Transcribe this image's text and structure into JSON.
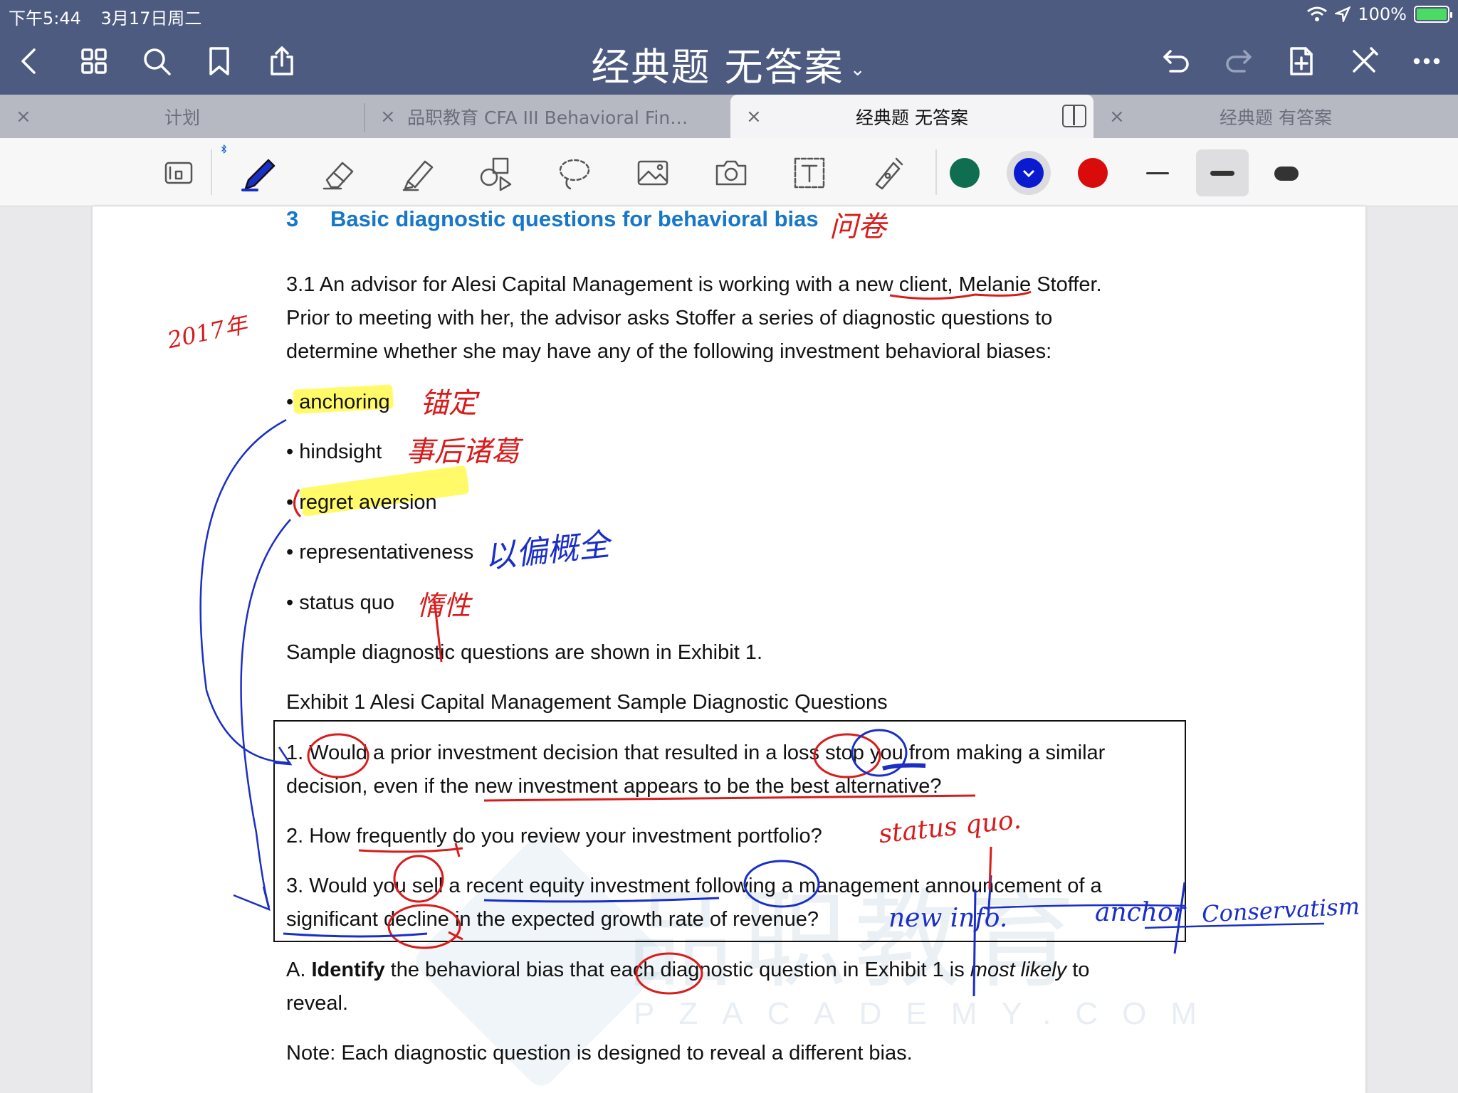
{
  "status_bar": {
    "time": "下午5:44",
    "date": "3月17日周二",
    "battery": "100%"
  },
  "nav": {
    "title": "经典题 无答案",
    "title_caret": "⌄"
  },
  "tabs": [
    {
      "label": "计划",
      "active": false
    },
    {
      "label": "品职教育 CFA III Behavioral Fina...",
      "active": false
    },
    {
      "label": "经典题 无答案",
      "active": true
    },
    {
      "label": "经典题 有答案",
      "active": false
    }
  ],
  "tab_close": "×",
  "toolbar": {
    "colors": [
      "#0e6e4f",
      "#0a1ad0",
      "#d90b0b"
    ],
    "selected_color": "#0a1ad0"
  },
  "document": {
    "heading_number": "3",
    "heading_text": "Basic diagnostic questions for behavioral bias",
    "intro_1": "3.1   An advisor for Alesi Capital Management is working with a new client, Melanie Stoffer.",
    "intro_2": "Prior  to  meeting  with  her,  the  advisor  asks  Stoffer  a  series  of  diagnostic  questions  to",
    "intro_3": "determine whether she may have any of the following investment behavioral biases:",
    "bullets": [
      "anchoring",
      "hindsight",
      "regret aversion",
      "representativeness",
      "status quo"
    ],
    "sample_line": "Sample diagnostic questions are shown in Exhibit 1.",
    "exhibit_title": "Exhibit 1 Alesi Capital Management Sample Diagnostic Questions",
    "q1_a": "1. Would a prior investment decision that resulted in a loss stop you from making a similar",
    "q1_b": "decision, even if the new investment appears to be the best alternative?",
    "q2": "2. How frequently do you review your investment portfolio?",
    "q3_a": "3. Would you sell a recent equity investment following a management announcement of a",
    "q3_b": "significant decline in the expected growth rate of revenue?",
    "a_prefix": "A. ",
    "a_bold": "Identify",
    "a_mid": " the behavioral bias that each diagnostic question in Exhibit 1 is ",
    "a_italic": "most likely",
    "a_end": " to",
    "a_line2": "reveal.",
    "note": "Note: Each diagnostic question is designed to reveal a different bias."
  },
  "watermark": {
    "main": "品职教育",
    "sub": "PZACADEMY.COM"
  },
  "handwriting": {
    "wenjuan": "问卷",
    "year": "2017年",
    "anchoring_cn": "锚定",
    "hindsight_cn": "事后诸葛",
    "repr_cn": "以偏概全",
    "status_cn": "惰性",
    "status_quo": "status quo.",
    "new_info": "new info.",
    "anchor": "anchor",
    "conservatism": "Conservatism"
  }
}
